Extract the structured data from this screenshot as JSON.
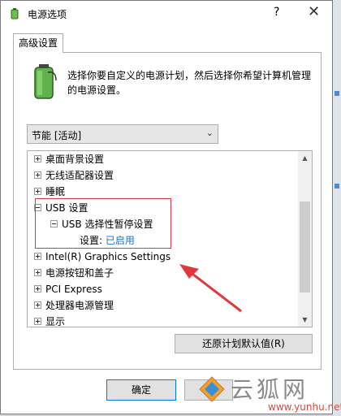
{
  "window": {
    "title": "电源选项",
    "help_glyph": "?",
    "close_glyph": "✕"
  },
  "tab": {
    "label": "高级设置"
  },
  "description": "选择你要自定义的电源计划，然后选择你希望计算机管理的电源设置。",
  "plan_select": {
    "value": "节能 [活动]",
    "chevron": "⌄"
  },
  "tree": {
    "items": [
      {
        "label": "桌面背景设置",
        "expander": "plus"
      },
      {
        "label": "无线适配器设置",
        "expander": "plus"
      },
      {
        "label": "睡眠",
        "expander": "plus"
      },
      {
        "label": "USB 设置",
        "expander": "minus"
      },
      {
        "label": "USB 选择性暂停设置",
        "expander": "minus"
      },
      {
        "label": "设置:",
        "value": "已启用"
      },
      {
        "label": "Intel(R) Graphics Settings",
        "expander": "plus"
      },
      {
        "label": "电源按钮和盖子",
        "expander": "plus"
      },
      {
        "label": "PCI Express",
        "expander": "plus"
      },
      {
        "label": "处理器电源管理",
        "expander": "plus"
      },
      {
        "label": "显示",
        "expander": "plus"
      }
    ],
    "scroll_up": "▲",
    "scroll_down": "▼"
  },
  "buttons": {
    "restore": "还原计划默认值(R)",
    "ok": "确定"
  },
  "watermark": {
    "text": "云狐网",
    "url": "www.yunhu.net"
  },
  "colors": {
    "accent": "#0078d7",
    "highlight": "#e0383c",
    "link": "#1a73c8"
  }
}
